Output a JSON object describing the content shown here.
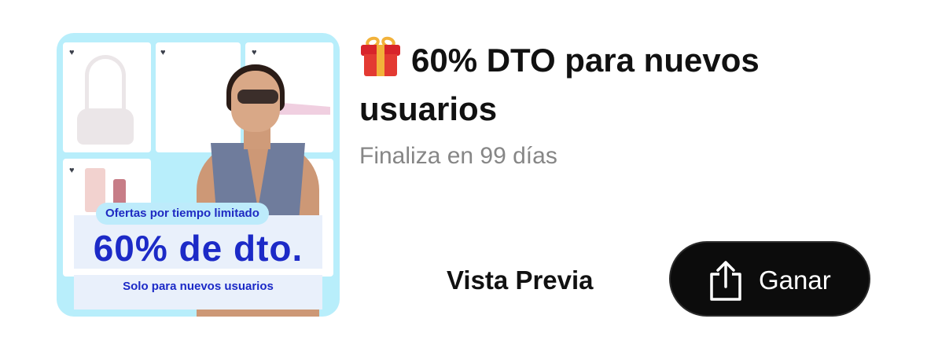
{
  "promo_image": {
    "badge": "Ofertas por tiempo limitado",
    "headline": "60% de dto.",
    "footer": "Solo para nuevos usuarios",
    "accent_color": "#1c2ac7",
    "background_color": "#b8eefb"
  },
  "offer": {
    "icon": "gift-icon",
    "title": "60% DTO para nuevos usuarios",
    "subtitle": "Finaliza en 99 días"
  },
  "actions": {
    "preview_label": "Vista Previa",
    "earn_label": "Ganar",
    "earn_icon": "share-icon"
  }
}
